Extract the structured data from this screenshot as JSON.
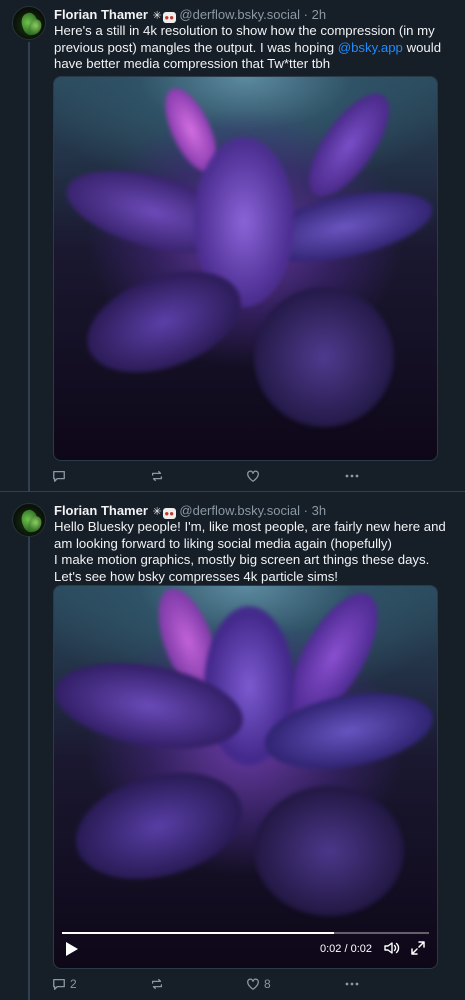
{
  "posts": [
    {
      "author": "Florian Thamer",
      "emoji_1": "✳",
      "emoji_2": "👀",
      "handle": "@derflow.bsky.social",
      "separator": "·",
      "time": "2h",
      "text_before": "Here's a still in 4k resolution to show how the compression (in my previous post) mangles the output. I was hoping ",
      "mention": "@bsky.app",
      "text_after": " would have better media compression that Tw*tter tbh",
      "actions": {
        "reply_count": "",
        "repost_count": "",
        "like_count": ""
      }
    },
    {
      "author": "Florian Thamer",
      "emoji_1": "✳",
      "emoji_2": "👀",
      "handle": "@derflow.bsky.social",
      "separator": "·",
      "time": "3h",
      "text_line1": "Hello Bluesky people! I'm, like most people, are fairly new here and am looking forward to liking social media again (hopefully)",
      "text_line2": "I make motion graphics, mostly big screen art things these days. Let's see how bsky compresses 4k particle sims!",
      "video": {
        "time_readout": "0:02 / 0:02",
        "progress": 0.74
      },
      "actions": {
        "reply_count": "2",
        "repost_count": "",
        "like_count": "8"
      }
    }
  ],
  "icons": {
    "reply": "speech-bubble-icon",
    "repost": "repost-arrows-icon",
    "like": "heart-icon",
    "more": "ellipsis-icon",
    "play": "play-icon",
    "volume": "speaker-icon",
    "fullscreen": "expand-icon"
  },
  "colors": {
    "background": "#161e27",
    "mention": "#208bfe",
    "muted": "#8b98a5",
    "divider": "#2e4052"
  }
}
